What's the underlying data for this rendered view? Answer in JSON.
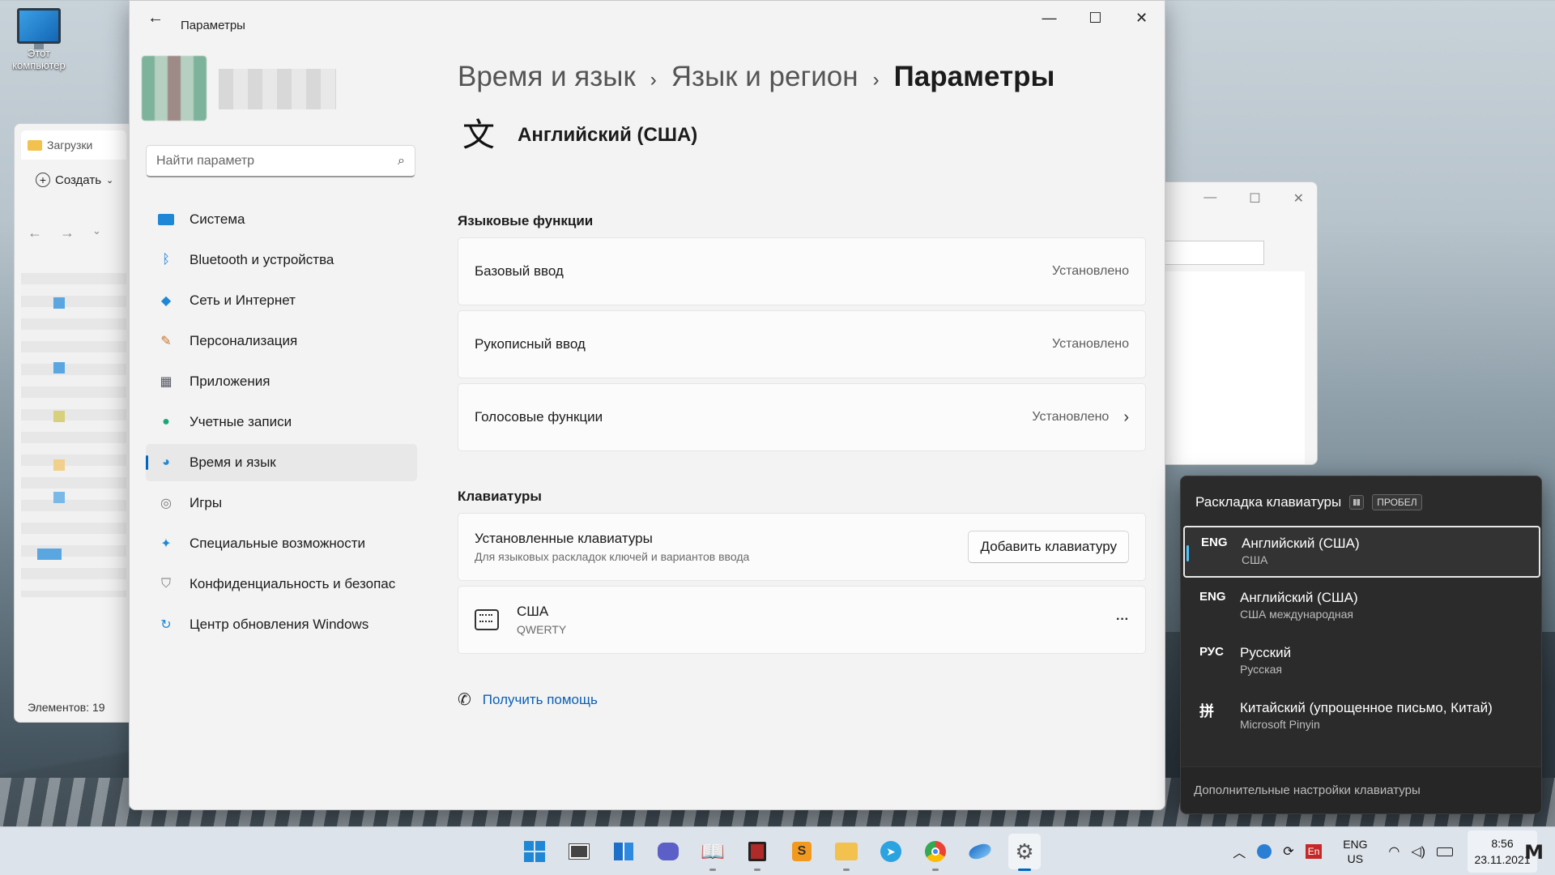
{
  "desktop": {
    "this_pc_label": "Этот компьютер"
  },
  "explorer": {
    "tab_label": "Загрузки",
    "create_label": "Создать",
    "status": "Элементов: 19"
  },
  "settings": {
    "app_title": "Параметры",
    "search_placeholder": "Найти параметр",
    "nav": [
      {
        "label": "Система",
        "icon": "display-icon"
      },
      {
        "label": "Bluetooth и устройства",
        "icon": "bluetooth-icon"
      },
      {
        "label": "Сеть и Интернет",
        "icon": "wifi-icon"
      },
      {
        "label": "Персонализация",
        "icon": "brush-icon"
      },
      {
        "label": "Приложения",
        "icon": "apps-icon"
      },
      {
        "label": "Учетные записи",
        "icon": "person-icon"
      },
      {
        "label": "Время и язык",
        "icon": "globe-clock-icon",
        "active": true
      },
      {
        "label": "Игры",
        "icon": "gamepad-icon"
      },
      {
        "label": "Специальные возможности",
        "icon": "accessibility-icon"
      },
      {
        "label": "Конфиденциальность и безопас",
        "icon": "shield-icon"
      },
      {
        "label": "Центр обновления Windows",
        "icon": "update-icon"
      }
    ],
    "breadcrumb": [
      "Время и язык",
      "Язык и регион",
      "Параметры"
    ],
    "language_name": "Английский (США)",
    "language_features": {
      "title": "Языковые функции",
      "items": [
        {
          "label": "Базовый ввод",
          "status": "Установлено"
        },
        {
          "label": "Рукописный ввод",
          "status": "Установлено"
        },
        {
          "label": "Голосовые функции",
          "status": "Установлено"
        }
      ]
    },
    "keyboards": {
      "title": "Клавиатуры",
      "installed_label": "Установленные клавиатуры",
      "installed_sub": "Для языковых раскладок ключей и вариантов ввода",
      "add_button": "Добавить клавиатуру",
      "layout_name": "США",
      "layout_type": "QWERTY",
      "more": "···"
    },
    "help_link": "Получить помощь"
  },
  "flyout": {
    "title": "Раскладка клавиатуры",
    "shortcut_key": "ПРОБЕЛ",
    "items": [
      {
        "code": "ENG",
        "name": "Английский (США)",
        "sub": "США",
        "selected": true
      },
      {
        "code": "ENG",
        "name": "Английский (США)",
        "sub": "США международная"
      },
      {
        "code": "РУС",
        "name": "Русский",
        "sub": "Русская"
      },
      {
        "code": "拼",
        "name": "Китайский (упрощенное письмо, Китай)",
        "sub": "Microsoft Pinyin"
      }
    ],
    "footer": "Дополнительные настройки клавиатуры"
  },
  "taskbar": {
    "lang_top": "ENG",
    "lang_bottom": "US",
    "time": "8:56",
    "date": "23.11.2021",
    "ime_badge": "En"
  },
  "colors": {
    "accent": "#0067c0",
    "flyout_bg": "#2b2b2b"
  }
}
